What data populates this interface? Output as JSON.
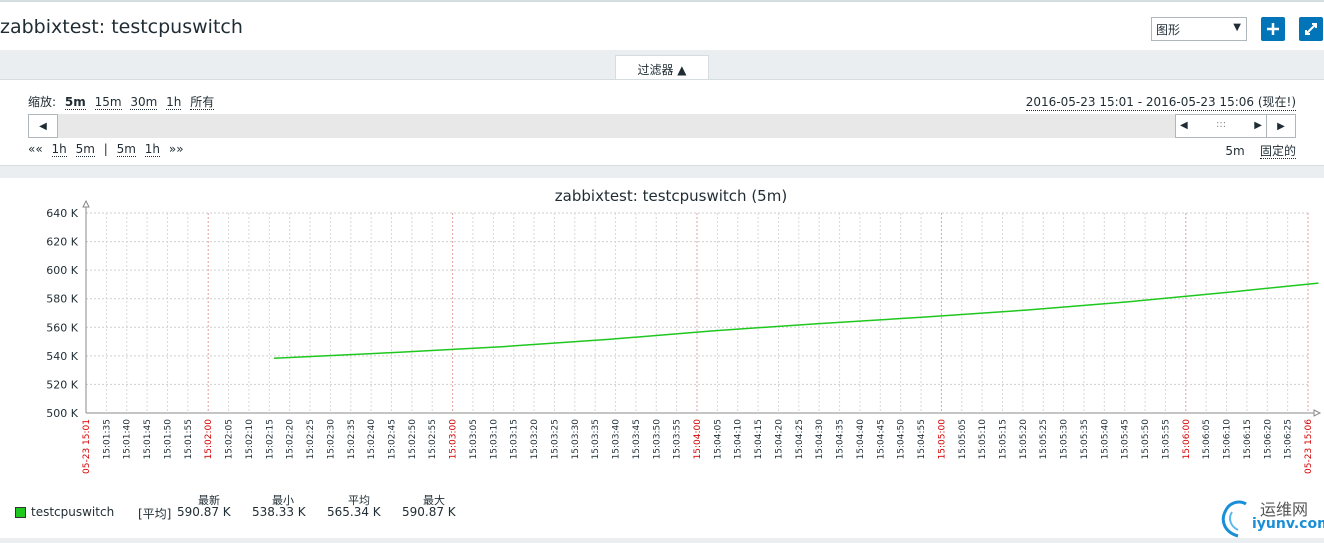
{
  "header": {
    "title": "zabbixtest: testcpuswitch",
    "view_select": "图形",
    "add_icon": "plus-icon",
    "fullscreen_icon": "fullscreen-icon"
  },
  "filter": {
    "tab_label": "过滤器 ▲",
    "zoom_label": "缩放:",
    "zoom_options": [
      "5m",
      "15m",
      "30m",
      "1h",
      "所有"
    ],
    "range": "2016-05-23 15:01 - 2016-05-23 15:06 (现在!)",
    "slider_grip": ":::",
    "nav": {
      "back_all": "««",
      "back_1h": "1h",
      "back_5m": "5m",
      "separator": "|",
      "fwd_5m": "5m",
      "fwd_1h": "1h",
      "fwd_all": "»»"
    },
    "period": "5m",
    "fixed": "固定的"
  },
  "chart_data": {
    "type": "line",
    "title": "zabbixtest: testcpuswitch (5m)",
    "y_ticks": [
      "640 K",
      "620 K",
      "600 K",
      "580 K",
      "560 K",
      "540 K",
      "520 K",
      "500 K"
    ],
    "ylim": [
      500,
      640
    ],
    "x_labels": [
      "05-23 15:01",
      "15:01:35",
      "15:01:40",
      "15:01:45",
      "15:01:50",
      "15:01:55",
      "15:02:00",
      "15:02:05",
      "15:02:10",
      "15:02:15",
      "15:02:20",
      "15:02:25",
      "15:02:30",
      "15:02:35",
      "15:02:40",
      "15:02:45",
      "15:02:50",
      "15:02:55",
      "15:03:00",
      "15:03:05",
      "15:03:10",
      "15:03:15",
      "15:03:20",
      "15:03:25",
      "15:03:30",
      "15:03:35",
      "15:03:40",
      "15:03:45",
      "15:03:50",
      "15:03:55",
      "15:04:00",
      "15:04:05",
      "15:04:10",
      "15:04:15",
      "15:04:20",
      "15:04:25",
      "15:04:30",
      "15:04:35",
      "15:04:40",
      "15:04:45",
      "15:04:50",
      "15:04:55",
      "15:05:00",
      "15:05:05",
      "15:05:10",
      "15:05:15",
      "15:05:20",
      "15:05:25",
      "15:05:30",
      "15:05:35",
      "15:05:40",
      "15:05:45",
      "15:05:50",
      "15:05:55",
      "15:06:00",
      "15:06:05",
      "15:06:10",
      "15:06:15",
      "15:06:20",
      "15:06:25",
      "05-23 15:06"
    ],
    "red_labels": [
      "05-23 15:01",
      "15:02:00",
      "15:03:00",
      "15:04:00",
      "15:05:00",
      "15:06:00",
      "05-23 15:06"
    ],
    "series": [
      {
        "name": "testcpuswitch",
        "color": "#1ec81e",
        "x_minutes_from_start": [
          0.9,
          1.5,
          2.0,
          2.5,
          3.0,
          3.5,
          4.0,
          4.5,
          5.0,
          5.5,
          5.9
        ],
        "values": [
          538.3,
          542.5,
          546.5,
          551.5,
          557.5,
          562.5,
          567.0,
          572.0,
          578.0,
          585.0,
          590.9
        ]
      }
    ],
    "grid": true
  },
  "legend": {
    "name": "testcpuswitch",
    "func": "[平均]",
    "headers": [
      "最新",
      "最小",
      "平均",
      "最大"
    ],
    "values": [
      "590.87 K",
      "538.33 K",
      "565.34 K",
      "590.87 K"
    ]
  },
  "watermark": {
    "text": "运维网",
    "url": "iyunv.com"
  }
}
